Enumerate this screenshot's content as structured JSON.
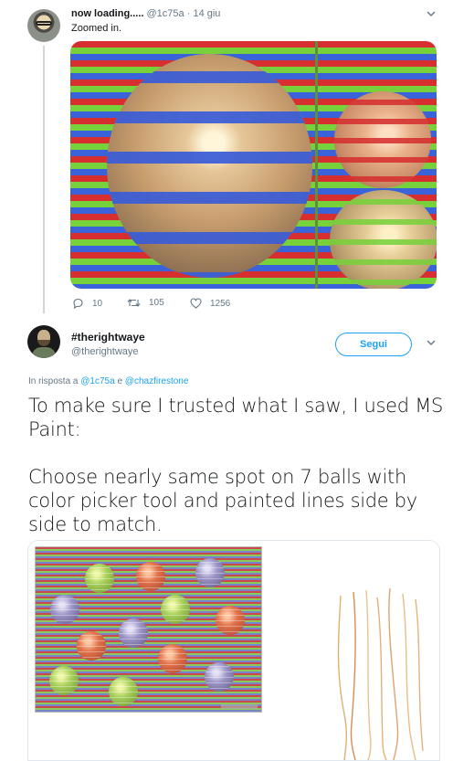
{
  "tweet1": {
    "display_name": "now loading.....",
    "handle": "@1c75a",
    "separator": "·",
    "date": "14 giu",
    "text": "Zoomed in.",
    "actions": [
      {
        "icon": "reply-icon",
        "count": "10"
      },
      {
        "icon": "retweet-icon",
        "count": "105"
      },
      {
        "icon": "heart-icon",
        "count": "1256"
      }
    ]
  },
  "tweet2": {
    "display_name": "#therightwaye",
    "handle": "@therightwaye",
    "follow_label": "Segui",
    "reply_prefix": "In risposta a",
    "reply_user1": "@1c75a",
    "reply_join": "e",
    "reply_user2": "@chazfirestone",
    "text": "To make sure I trusted what I saw, I used MS Paint:\n\nChoose nearly same spot on 7 balls with color picker tool and painted lines side by side to match."
  },
  "colors": {
    "link": "#1da1f2",
    "secondary_text": "#657786",
    "thread_line": "#ccd6dd"
  }
}
